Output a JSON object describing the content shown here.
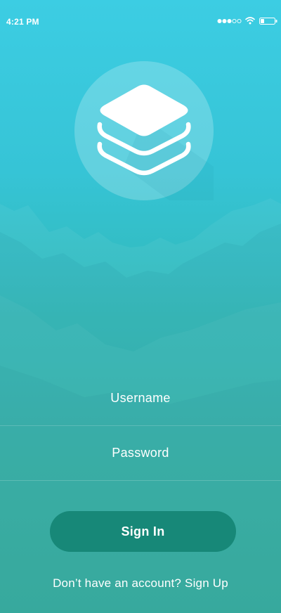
{
  "status_bar": {
    "time": "4:21 PM"
  },
  "icons": {
    "logo": "layers-icon",
    "signal": "signal-strength-icon",
    "wifi": "wifi-icon",
    "battery": "battery-icon"
  },
  "colors": {
    "background_top": "#3ccde3",
    "background_bottom": "#2aac9b",
    "button": "#178878",
    "text": "#ffffff"
  },
  "form": {
    "username_placeholder": "Username",
    "password_placeholder": "Password",
    "signin_label": "Sign In"
  },
  "footer": {
    "prompt": "Don’t have an account?",
    "signup_label": "Sign Up"
  }
}
